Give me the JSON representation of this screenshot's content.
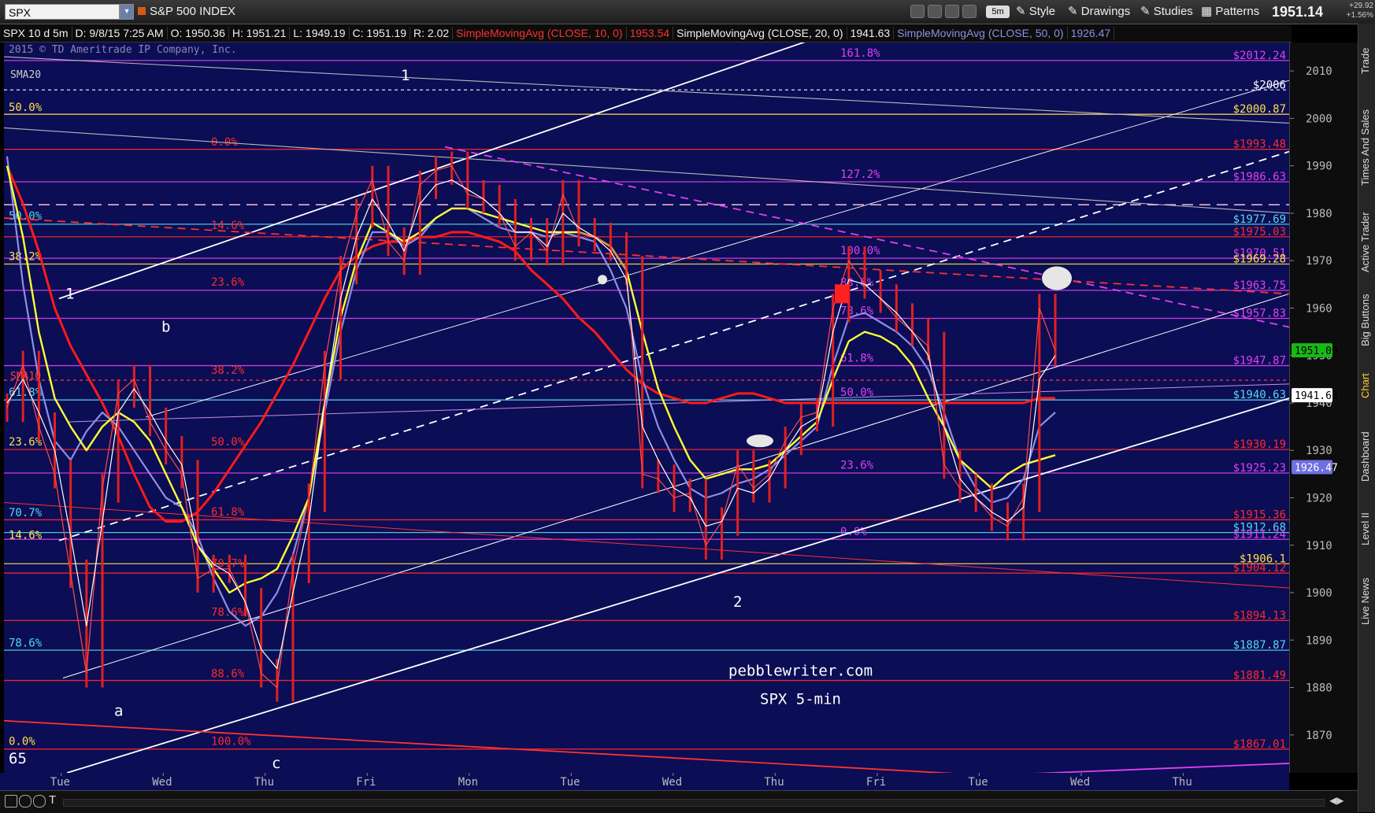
{
  "header": {
    "symbol": "SPX",
    "instrument_name": "S&P 500 INDEX",
    "timeframe": "5m",
    "style_label": "Style",
    "drawings_label": "Drawings",
    "studies_label": "Studies",
    "patterns_label": "Patterns",
    "last_price": "1951.14",
    "net_change": "+29.92",
    "pct_change": "+1.56%"
  },
  "study_bar": {
    "chart_desc": "SPX 10 d 5m",
    "date": "D: 9/8/15 7:25 AM",
    "open": "O: 1950.36",
    "high": "H: 1951.21",
    "low": "L: 1949.19",
    "close": "C: 1951.19",
    "range": "R: 2.02",
    "sma10_label": "SimpleMovingAvg (CLOSE, 10, 0)",
    "sma10_value": "1953.54",
    "sma20_label": "SimpleMovingAvg (CLOSE, 20, 0)",
    "sma20_value": "1941.63",
    "sma50_label": "SimpleMovingAvg (CLOSE, 50, 0)",
    "sma50_value": "1926.47"
  },
  "sidebar_tabs": [
    "Trade",
    "Times And Sales",
    "Active Trader",
    "Big Buttons",
    "Chart",
    "Dashboard",
    "Level II",
    "Live News"
  ],
  "active_sidebar_tab": "Chart",
  "colors": {
    "plot_bg": "#0b0d55",
    "sma20": "#ffff33",
    "sma50": "#8e8ee6",
    "sma10": "#ffffff",
    "ma_thick": "#ff1a1a",
    "price_bars": "#e02020",
    "fib_red": "#ff2a2a",
    "fib_yellow": "#ffe14a",
    "fib_cyan": "#56d8e8",
    "fib_magenta": "#e040f0",
    "channel": "#ffffff"
  },
  "chart_data": {
    "type": "line",
    "title": "SPX 5-min",
    "ylim": [
      1862,
      2016
    ],
    "y_ticks": [
      1870,
      1880,
      1890,
      1900,
      1910,
      1920,
      1930,
      1940,
      1950,
      1960,
      1970,
      1980,
      1990,
      2000,
      2010
    ],
    "x_labels": [
      "Tue",
      "Wed",
      "Thu",
      "Fri",
      "Mon",
      "Tue",
      "Wed",
      "Thu",
      "Fri",
      "Tue",
      "Wed",
      "Thu"
    ],
    "price_close": [
      1939,
      1948,
      1935,
      1925,
      1904,
      1883,
      1922,
      1942,
      1945,
      1936,
      1930,
      1925,
      1903,
      1905,
      1905,
      1898,
      1883,
      1880,
      1905,
      1920,
      1948,
      1968,
      1980,
      1987,
      1974,
      1970,
      1986,
      1989,
      1990,
      1984,
      1983,
      1980,
      1973,
      1976,
      1972,
      1984,
      1976,
      1975,
      1973,
      1968,
      1925,
      1924,
      1920,
      1921,
      1910,
      1915,
      1927,
      1922,
      1925,
      1932,
      1937,
      1938,
      1960,
      1970,
      1965,
      1962,
      1958,
      1955,
      1952,
      1927,
      1922,
      1920,
      1916,
      1914,
      1920,
      1960,
      1951
    ],
    "sma10": [
      1940,
      1945,
      1938,
      1930,
      1912,
      1893,
      1915,
      1938,
      1943,
      1938,
      1932,
      1927,
      1910,
      1906,
      1904,
      1898,
      1888,
      1884,
      1900,
      1915,
      1940,
      1962,
      1975,
      1983,
      1978,
      1972,
      1982,
      1986,
      1987,
      1985,
      1983,
      1980,
      1976,
      1976,
      1973,
      1980,
      1977,
      1975,
      1972,
      1966,
      1935,
      1928,
      1922,
      1920,
      1914,
      1915,
      1922,
      1921,
      1924,
      1930,
      1935,
      1937,
      1955,
      1966,
      1965,
      1962,
      1959,
      1955,
      1950,
      1935,
      1924,
      1920,
      1917,
      1915,
      1918,
      1945,
      1950
    ],
    "sma20": [
      1990,
      1975,
      1955,
      1941,
      1935,
      1930,
      1935,
      1938,
      1936,
      1932,
      1925,
      1918,
      1910,
      1905,
      1900,
      1902,
      1903,
      1905,
      1912,
      1920,
      1940,
      1958,
      1970,
      1978,
      1976,
      1974,
      1976,
      1979,
      1981,
      1981,
      1980,
      1979,
      1978,
      1977,
      1976,
      1976,
      1976,
      1975,
      1973,
      1968,
      1955,
      1943,
      1935,
      1928,
      1924,
      1925,
      1926,
      1926,
      1927,
      1930,
      1933,
      1936,
      1945,
      1953,
      1955,
      1954,
      1952,
      1948,
      1941,
      1935,
      1928,
      1925,
      1922,
      1925,
      1927,
      1928,
      1929
    ],
    "sma50": [
      1992,
      1965,
      1945,
      1932,
      1928,
      1934,
      1938,
      1935,
      1930,
      1925,
      1920,
      1918,
      1912,
      1903,
      1896,
      1893,
      1895,
      1900,
      1908,
      1920,
      1938,
      1955,
      1968,
      1976,
      1976,
      1973,
      1975,
      1979,
      1981,
      1981,
      1979,
      1977,
      1976,
      1976,
      1975,
      1976,
      1975,
      1974,
      1968,
      1960,
      1945,
      1935,
      1928,
      1922,
      1920,
      1921,
      1923,
      1924,
      1926,
      1929,
      1932,
      1935,
      1948,
      1958,
      1959,
      1957,
      1955,
      1952,
      1947,
      1938,
      1928,
      1922,
      1919,
      1920,
      1924,
      1935,
      1938
    ],
    "ma_thick": [
      1990,
      1982,
      1972,
      1960,
      1952,
      1946,
      1940,
      1933,
      1925,
      1918,
      1915,
      1915,
      1917,
      1921,
      1926,
      1931,
      1936,
      1942,
      1948,
      1955,
      1962,
      1968,
      1971,
      1973,
      1974,
      1974,
      1975,
      1975,
      1976,
      1976,
      1975,
      1974,
      1972,
      1968,
      1965,
      1962,
      1958,
      1955,
      1951,
      1947,
      1944,
      1942,
      1941,
      1940,
      1940,
      1941,
      1942,
      1942,
      1941,
      1940,
      1940,
      1940,
      1940,
      1940,
      1940,
      1940,
      1940,
      1940,
      1940,
      1940,
      1940,
      1940,
      1940,
      1940,
      1940,
      1941,
      1941
    ],
    "price_labels": [
      {
        "text": "$2012.24",
        "value": 2012.2,
        "color": "#e040f0"
      },
      {
        "text": "$2006",
        "value": 2006,
        "color": "#ffffff"
      },
      {
        "text": "$2000.87",
        "value": 2000.87,
        "color": "#ffe14a"
      },
      {
        "text": "$1993.48",
        "value": 1993.48,
        "color": "#ff2a2a"
      },
      {
        "text": "$1986.63",
        "value": 1986.63,
        "color": "#e040f0"
      },
      {
        "text": "$1977.69",
        "value": 1977.69,
        "color": "#56d8e8"
      },
      {
        "text": "$1975.03",
        "value": 1975.03,
        "color": "#ff2a2a"
      },
      {
        "text": "$1970.51",
        "value": 1970.51,
        "color": "#e040f0"
      },
      {
        "text": "$1969.28",
        "value": 1969.28,
        "color": "#ffe14a"
      },
      {
        "text": "$1963.75",
        "value": 1963.75,
        "color": "#e040f0"
      },
      {
        "text": "$1957.83",
        "value": 1957.83,
        "color": "#e040f0"
      },
      {
        "text": "$1947.87",
        "value": 1947.87,
        "color": "#e040f0"
      },
      {
        "text": "$1940.63",
        "value": 1940.63,
        "color": "#56d8e8"
      },
      {
        "text": "$1930.19",
        "value": 1930.19,
        "color": "#ff2a2a"
      },
      {
        "text": "$1925.23",
        "value": 1925.23,
        "color": "#e040f0"
      },
      {
        "text": "$1915.36",
        "value": 1915.36,
        "color": "#ff2a2a"
      },
      {
        "text": "$1912.68",
        "value": 1912.68,
        "color": "#56d8e8"
      },
      {
        "text": "$1911.24",
        "value": 1911.24,
        "color": "#e040f0"
      },
      {
        "text": "$1906.1",
        "value": 1906.1,
        "color": "#ffe14a"
      },
      {
        "text": "$1904.12",
        "value": 1904.12,
        "color": "#ff2a2a"
      },
      {
        "text": "$1894.13",
        "value": 1894.13,
        "color": "#ff2a2a"
      },
      {
        "text": "$1887.87",
        "value": 1887.87,
        "color": "#56d8e8"
      },
      {
        "text": "$1881.49",
        "value": 1881.49,
        "color": "#ff2a2a"
      },
      {
        "text": "$1867.01",
        "value": 1867.01,
        "color": "#ff2a2a"
      }
    ],
    "axis_badges": [
      {
        "text": "1951.09",
        "value": 1951.09,
        "bg": "#18b818",
        "fg": "#000000"
      },
      {
        "text": "1941.63",
        "value": 1941.63,
        "bg": "#ffffff",
        "fg": "#000000"
      },
      {
        "text": "1926.47",
        "value": 1926.47,
        "bg": "#7070e0",
        "fg": "#ffffff"
      }
    ],
    "fib_labels": [
      {
        "text": "50.0%",
        "value": 2001.1,
        "color": "#ffe14a",
        "side": "left"
      },
      {
        "text": "50.0%",
        "value": 1978.2,
        "color": "#56d8e8",
        "side": "left"
      },
      {
        "text": "38.2%",
        "value": 1969.6,
        "color": "#ffe14a",
        "side": "left"
      },
      {
        "text": "61.8%",
        "value": 1941.0,
        "color": "#56d8e8",
        "side": "left"
      },
      {
        "text": "23.6%",
        "value": 1930.5,
        "color": "#ffe14a",
        "side": "left"
      },
      {
        "text": "70.7%",
        "value": 1915.6,
        "color": "#56d8e8",
        "side": "left"
      },
      {
        "text": "14.6%",
        "value": 1910.9,
        "color": "#ffe14a",
        "side": "left"
      },
      {
        "text": "78.6%",
        "value": 1888.1,
        "color": "#56d8e8",
        "side": "left"
      },
      {
        "text": "0.0%",
        "value": 1867.4,
        "color": "#ffe14a",
        "side": "left"
      },
      {
        "text": "0.0%",
        "value": 1993.8,
        "color": "#ff2a2a",
        "side": "mid1"
      },
      {
        "text": "14.6%",
        "value": 1976.2,
        "color": "#ff2a2a",
        "side": "mid1"
      },
      {
        "text": "23.6%",
        "value": 1964.2,
        "color": "#ff2a2a",
        "side": "mid1"
      },
      {
        "text": "38.2%",
        "value": 1945.6,
        "color": "#ff2a2a",
        "side": "mid1"
      },
      {
        "text": "50.0%",
        "value": 1930.5,
        "color": "#ff2a2a",
        "side": "mid1"
      },
      {
        "text": "61.8%",
        "value": 1915.8,
        "color": "#ff2a2a",
        "side": "mid1"
      },
      {
        "text": "70.7%",
        "value": 1904.9,
        "color": "#ff2a2a",
        "side": "mid1"
      },
      {
        "text": "78.6%",
        "value": 1894.6,
        "color": "#ff2a2a",
        "side": "mid1"
      },
      {
        "text": "88.6%",
        "value": 1881.7,
        "color": "#ff2a2a",
        "side": "mid1"
      },
      {
        "text": "100.0%",
        "value": 1867.4,
        "color": "#ff2a2a",
        "side": "mid1"
      },
      {
        "text": "161.8%",
        "value": 2012.5,
        "color": "#e040f0",
        "side": "mid2"
      },
      {
        "text": "127.2%",
        "value": 1987.0,
        "color": "#e040f0",
        "side": "mid2"
      },
      {
        "text": "100.0%",
        "value": 1970.9,
        "color": "#e040f0",
        "side": "mid2"
      },
      {
        "text": "88.6%",
        "value": 1964.1,
        "color": "#e040f0",
        "side": "mid2"
      },
      {
        "text": "78.6%",
        "value": 1958.2,
        "color": "#e040f0",
        "side": "mid2"
      },
      {
        "text": "61.8%",
        "value": 1948.2,
        "color": "#e040f0",
        "side": "mid2"
      },
      {
        "text": "50.0%",
        "value": 1941.0,
        "color": "#e040f0",
        "side": "mid2"
      },
      {
        "text": "23.6%",
        "value": 1925.6,
        "color": "#e040f0",
        "side": "mid2"
      },
      {
        "text": "0.0%",
        "value": 1911.6,
        "color": "#e040f0",
        "side": "mid2"
      }
    ],
    "annotations": [
      {
        "text": "1",
        "x": 0.48,
        "value": 2008
      },
      {
        "text": "1",
        "x": 0.05,
        "value": 1962
      },
      {
        "text": "b",
        "x": 0.12,
        "value": 1955
      },
      {
        "text": "a",
        "x": 0.08,
        "value": 1874
      },
      {
        "text": "c",
        "x": 0.21,
        "value": 1863
      },
      {
        "text": "2",
        "x": 3.6,
        "value": 1897
      },
      {
        "text": "65",
        "x": 0.0,
        "value": 1864
      }
    ],
    "small_labels": [
      "SMA20",
      "SMA10"
    ],
    "watermark": [
      "pebblewriter.com",
      "SPX 5-min"
    ],
    "copyright": "2015 © TD Ameritrade IP Company, Inc."
  }
}
